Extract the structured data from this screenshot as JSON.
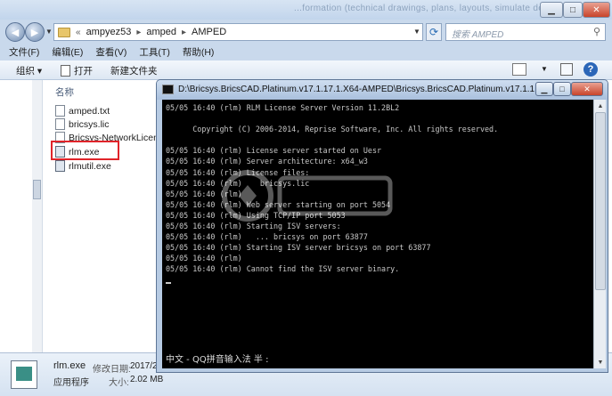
{
  "explorer": {
    "top_text": "...formation (technical drawings, plans, layouts, simulate designs quality",
    "address": {
      "prefix": "«",
      "parts": [
        "ampyez53",
        "amped",
        "AMPED"
      ],
      "separator": "▸"
    },
    "search_placeholder": "搜索 AMPED",
    "menu": [
      "文件(F)",
      "编辑(E)",
      "查看(V)",
      "工具(T)",
      "帮助(H)"
    ],
    "commands": {
      "organize": "组织 ▾",
      "open": "打开",
      "new_folder": "新建文件夹"
    },
    "column_header": "名称",
    "files": [
      {
        "name": "amped.txt",
        "type": "doc"
      },
      {
        "name": "bricsys.lic",
        "type": "doc"
      },
      {
        "name": "Bricsys-NetworkLicens",
        "type": "doc"
      },
      {
        "name": "rlm.exe",
        "type": "exe"
      },
      {
        "name": "rlmutil.exe",
        "type": "exe"
      }
    ],
    "details": {
      "name": "rlm.exe",
      "type": "应用程序",
      "modified_label": "修改日期:",
      "modified_value": "2017/2",
      "size_label": "大小:",
      "size_value": "2.02 MB"
    },
    "icons": {
      "back": "back-arrow-icon",
      "forward": "forward-arrow-icon",
      "refresh": "refresh-icon",
      "search": "search-icon",
      "help": "help-icon"
    }
  },
  "console": {
    "title": "D:\\Bricsys.BricsCAD.Platinum.v17.1.17.1.X64-AMPED\\Bricsys.BricsCAD.Platinum.v17.1.17.1...",
    "lines": [
      "05/05 16:40 (rlm) RLM License Server Version 11.2BL2",
      "",
      "      Copyright (C) 2006-2014, Reprise Software, Inc. All rights reserved.",
      "",
      "05/05 16:40 (rlm) License server started on Uesr",
      "05/05 16:40 (rlm) Server architecture: x64_w3",
      "05/05 16:40 (rlm) License files:",
      "05/05 16:40 (rlm)    bricsys.lic",
      "05/05 16:40 (rlm)",
      "05/05 16:40 (rlm) Web server starting on port 5054",
      "05/05 16:40 (rlm) Using TCP/IP port 5053",
      "05/05 16:40 (rlm) Starting ISV servers:",
      "05/05 16:40 (rlm)   ... bricsys on port 63877",
      "05/05 16:40 (rlm) Starting ISV server bricsys on port 63877",
      "05/05 16:40 (rlm)",
      "05/05 16:40 (rlm) Cannot find the ISV server binary."
    ],
    "ime_status": "中文 - QQ拼音输入法 半 :"
  }
}
